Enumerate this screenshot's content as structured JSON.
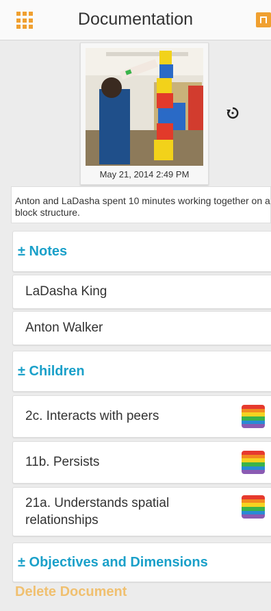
{
  "header": {
    "title": "Documentation",
    "menu_icon": "grid-menu-icon",
    "export_icon": "export-icon"
  },
  "photo": {
    "date": "May 21, 2014 2:49 PM",
    "rotate_icon": "rotate-icon"
  },
  "caption": "Anton and LaDasha spent 10 minutes working together on a block structure.",
  "notes": {
    "label": "± Notes"
  },
  "people": [
    {
      "name": "LaDasha King"
    },
    {
      "name": "Anton Walker"
    }
  ],
  "children": {
    "label": "± Children"
  },
  "objectives": [
    {
      "label": "2c. Interacts with peers",
      "icon": "rainbow-icon"
    },
    {
      "label": "11b. Persists",
      "icon": "rainbow-icon"
    },
    {
      "label": "21a. Understands spatial relationships",
      "icon": "rainbow-icon"
    }
  ],
  "objectives_section": {
    "label": "± Objectives and Dimensions"
  },
  "delete_label": "Delete Document",
  "colors": {
    "accent_orange": "#f0a030",
    "section_blue": "#1aa0c9",
    "rainbow": [
      "#e63a2e",
      "#f28a20",
      "#f5d320",
      "#3bb34a",
      "#2a8ad5",
      "#8a5bb3"
    ]
  }
}
